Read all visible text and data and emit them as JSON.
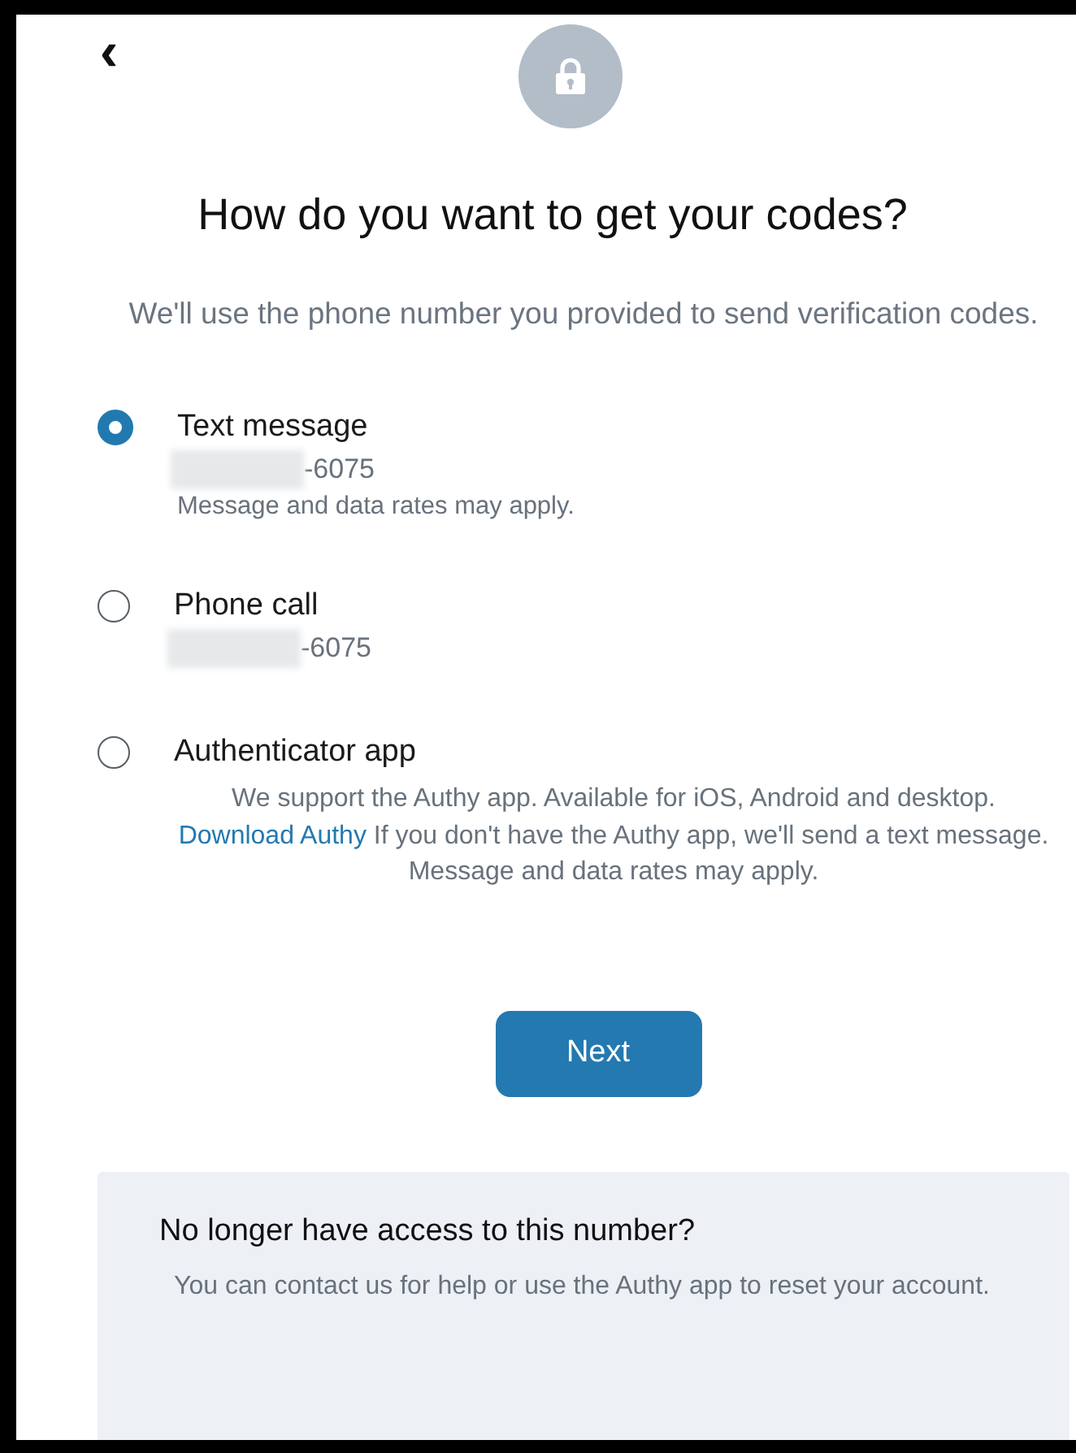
{
  "back_button": {
    "label": "‹"
  },
  "title": "How do you want to get your codes?",
  "subtitle": "We'll use the phone number you provided to send verification codes.",
  "options": [
    {
      "label": "Text message",
      "selected": true,
      "number": "-6075",
      "redacted": true,
      "note": "Message and data rates may apply."
    },
    {
      "label": "Phone call",
      "selected": false,
      "number": "-6075",
      "redacted": true
    },
    {
      "label": "Authenticator app",
      "selected": false,
      "description": {
        "link": "Download Authy",
        "before": "We support the Authy app. Available for iOS, Android and desktop.",
        "after": "If you don't have the Authy app, we'll send a text message. Message and data rates may apply."
      }
    }
  ],
  "next_button": "Next",
  "help_panel": {
    "heading": "No longer have access to this number?",
    "text": "You can contact us for help or use the Authy app to reset your account."
  }
}
